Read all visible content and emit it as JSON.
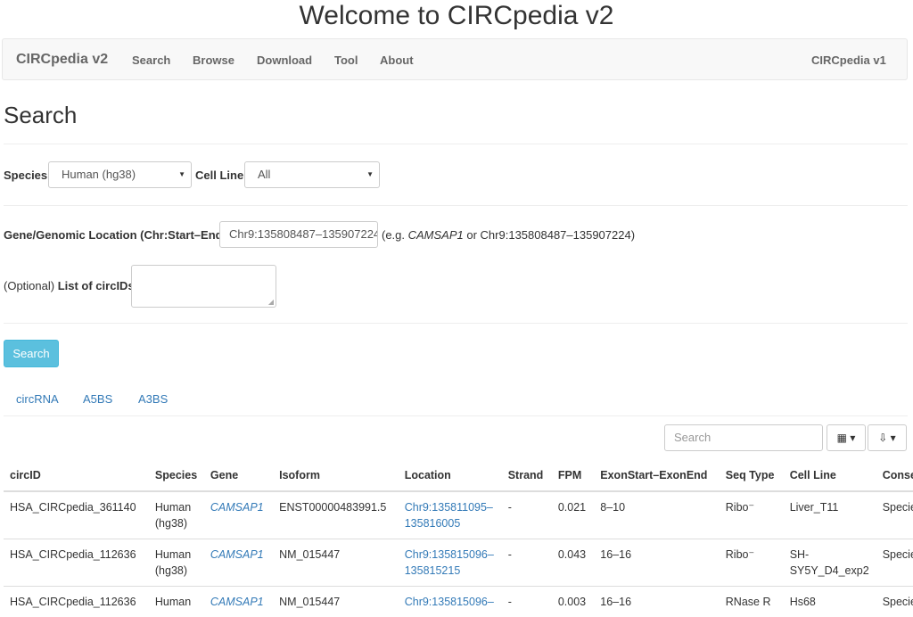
{
  "site_title": "Welcome to CIRCpedia v2",
  "navbar": {
    "brand": "CIRCpedia v2",
    "items": [
      "Search",
      "Browse",
      "Download",
      "Tool",
      "About"
    ],
    "right_link": "CIRCpedia v1"
  },
  "page_heading": "Search",
  "form": {
    "species_label": "Species",
    "species_value": "Human (hg38)",
    "cell_line_label": "Cell Line",
    "cell_line_value": "All",
    "location_label": "Gene/Genomic Location (Chr:Start–End)",
    "location_value": "Chr9:135808487–135907224",
    "location_hint_prefix": "(e.g. ",
    "location_hint_gene": "CAMSAP1",
    "location_hint_suffix": " or Chr9:135808487–135907224)",
    "circids_optional": "(Optional)",
    "circids_label": "List of circIDs",
    "search_button": "Search"
  },
  "tabs": [
    "circRNA",
    "A5BS",
    "A3BS"
  ],
  "table_toolbar": {
    "search_placeholder": "Search",
    "columns_icon": "grid-icon",
    "export_icon": "export-icon"
  },
  "table": {
    "headers": [
      "circID",
      "Species",
      "Gene",
      "Isoform",
      "Location",
      "Strand",
      "FPM",
      "ExonStart–ExonEnd",
      "Seq Type",
      "Cell Line",
      "Conser"
    ],
    "rows": [
      {
        "circID": "HSA_CIRCpedia_361140",
        "species": "Human (hg38)",
        "gene": "CAMSAP1",
        "isoform": "ENST00000483991.5",
        "location": "Chr9:135811095–135816005",
        "strand": "-",
        "fpm": "0.021",
        "exons": "8–10",
        "seq_type": "Ribo⁻",
        "cell_line": "Liver_T11",
        "conservation": "Species"
      },
      {
        "circID": "HSA_CIRCpedia_112636",
        "species": "Human (hg38)",
        "gene": "CAMSAP1",
        "isoform": "NM_015447",
        "location": "Chr9:135815096–135815215",
        "strand": "-",
        "fpm": "0.043",
        "exons": "16–16",
        "seq_type": "Ribo⁻",
        "cell_line": "SH-SY5Y_D4_exp2",
        "conservation": "Species"
      },
      {
        "circID": "HSA_CIRCpedia_112636",
        "species": "Human",
        "gene": "CAMSAP1",
        "isoform": "NM_015447",
        "location": "Chr9:135815096–",
        "strand": "-",
        "fpm": "0.003",
        "exons": "16–16",
        "seq_type": "RNase R",
        "cell_line": "Hs68",
        "conservation": "Species"
      }
    ]
  },
  "colors": {
    "link": "#337ab7",
    "search_button": "#5bc0de",
    "navbar_bg": "#f8f8f8"
  }
}
